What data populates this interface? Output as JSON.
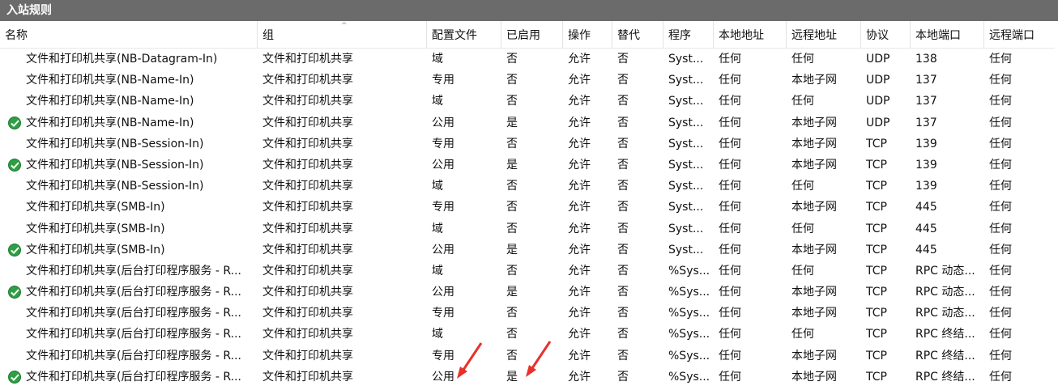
{
  "panel": {
    "title": "入站规则"
  },
  "columns": [
    "名称",
    "组",
    "配置文件",
    "已启用",
    "操作",
    "替代",
    "程序",
    "本地地址",
    "远程地址",
    "协议",
    "本地端口",
    "远程端口"
  ],
  "rows": [
    {
      "enabled_icon": false,
      "name": "文件和打印机共享(NB-Datagram-In)",
      "group": "文件和打印机共享",
      "profile": "域",
      "enabled": "否",
      "action": "允许",
      "override": "否",
      "program": "Syst...",
      "local_addr": "任何",
      "remote_addr": "任何",
      "protocol": "UDP",
      "local_port": "138",
      "remote_port": "任何"
    },
    {
      "enabled_icon": false,
      "name": "文件和打印机共享(NB-Name-In)",
      "group": "文件和打印机共享",
      "profile": "专用",
      "enabled": "否",
      "action": "允许",
      "override": "否",
      "program": "Syst...",
      "local_addr": "任何",
      "remote_addr": "本地子网",
      "protocol": "UDP",
      "local_port": "137",
      "remote_port": "任何"
    },
    {
      "enabled_icon": false,
      "name": "文件和打印机共享(NB-Name-In)",
      "group": "文件和打印机共享",
      "profile": "域",
      "enabled": "否",
      "action": "允许",
      "override": "否",
      "program": "Syst...",
      "local_addr": "任何",
      "remote_addr": "任何",
      "protocol": "UDP",
      "local_port": "137",
      "remote_port": "任何"
    },
    {
      "enabled_icon": true,
      "name": "文件和打印机共享(NB-Name-In)",
      "group": "文件和打印机共享",
      "profile": "公用",
      "enabled": "是",
      "action": "允许",
      "override": "否",
      "program": "Syst...",
      "local_addr": "任何",
      "remote_addr": "本地子网",
      "protocol": "UDP",
      "local_port": "137",
      "remote_port": "任何"
    },
    {
      "enabled_icon": false,
      "name": "文件和打印机共享(NB-Session-In)",
      "group": "文件和打印机共享",
      "profile": "专用",
      "enabled": "否",
      "action": "允许",
      "override": "否",
      "program": "Syst...",
      "local_addr": "任何",
      "remote_addr": "本地子网",
      "protocol": "TCP",
      "local_port": "139",
      "remote_port": "任何"
    },
    {
      "enabled_icon": true,
      "name": "文件和打印机共享(NB-Session-In)",
      "group": "文件和打印机共享",
      "profile": "公用",
      "enabled": "是",
      "action": "允许",
      "override": "否",
      "program": "Syst...",
      "local_addr": "任何",
      "remote_addr": "本地子网",
      "protocol": "TCP",
      "local_port": "139",
      "remote_port": "任何"
    },
    {
      "enabled_icon": false,
      "name": "文件和打印机共享(NB-Session-In)",
      "group": "文件和打印机共享",
      "profile": "域",
      "enabled": "否",
      "action": "允许",
      "override": "否",
      "program": "Syst...",
      "local_addr": "任何",
      "remote_addr": "任何",
      "protocol": "TCP",
      "local_port": "139",
      "remote_port": "任何"
    },
    {
      "enabled_icon": false,
      "name": "文件和打印机共享(SMB-In)",
      "group": "文件和打印机共享",
      "profile": "专用",
      "enabled": "否",
      "action": "允许",
      "override": "否",
      "program": "Syst...",
      "local_addr": "任何",
      "remote_addr": "本地子网",
      "protocol": "TCP",
      "local_port": "445",
      "remote_port": "任何"
    },
    {
      "enabled_icon": false,
      "name": "文件和打印机共享(SMB-In)",
      "group": "文件和打印机共享",
      "profile": "域",
      "enabled": "否",
      "action": "允许",
      "override": "否",
      "program": "Syst...",
      "local_addr": "任何",
      "remote_addr": "任何",
      "protocol": "TCP",
      "local_port": "445",
      "remote_port": "任何"
    },
    {
      "enabled_icon": true,
      "name": "文件和打印机共享(SMB-In)",
      "group": "文件和打印机共享",
      "profile": "公用",
      "enabled": "是",
      "action": "允许",
      "override": "否",
      "program": "Syst...",
      "local_addr": "任何",
      "remote_addr": "本地子网",
      "protocol": "TCP",
      "local_port": "445",
      "remote_port": "任何"
    },
    {
      "enabled_icon": false,
      "name": "文件和打印机共享(后台打印程序服务 - R...",
      "group": "文件和打印机共享",
      "profile": "域",
      "enabled": "否",
      "action": "允许",
      "override": "否",
      "program": "%Sys...",
      "local_addr": "任何",
      "remote_addr": "任何",
      "protocol": "TCP",
      "local_port": "RPC 动态...",
      "remote_port": "任何"
    },
    {
      "enabled_icon": true,
      "name": "文件和打印机共享(后台打印程序服务 - R...",
      "group": "文件和打印机共享",
      "profile": "公用",
      "enabled": "是",
      "action": "允许",
      "override": "否",
      "program": "%Sys...",
      "local_addr": "任何",
      "remote_addr": "本地子网",
      "protocol": "TCP",
      "local_port": "RPC 动态...",
      "remote_port": "任何"
    },
    {
      "enabled_icon": false,
      "name": "文件和打印机共享(后台打印程序服务 - R...",
      "group": "文件和打印机共享",
      "profile": "专用",
      "enabled": "否",
      "action": "允许",
      "override": "否",
      "program": "%Sys...",
      "local_addr": "任何",
      "remote_addr": "本地子网",
      "protocol": "TCP",
      "local_port": "RPC 动态...",
      "remote_port": "任何"
    },
    {
      "enabled_icon": false,
      "name": "文件和打印机共享(后台打印程序服务 - R...",
      "group": "文件和打印机共享",
      "profile": "域",
      "enabled": "否",
      "action": "允许",
      "override": "否",
      "program": "%Sys...",
      "local_addr": "任何",
      "remote_addr": "任何",
      "protocol": "TCP",
      "local_port": "RPC 终结...",
      "remote_port": "任何"
    },
    {
      "enabled_icon": false,
      "name": "文件和打印机共享(后台打印程序服务 - R...",
      "group": "文件和打印机共享",
      "profile": "专用",
      "enabled": "否",
      "action": "允许",
      "override": "否",
      "program": "%Sys...",
      "local_addr": "任何",
      "remote_addr": "本地子网",
      "protocol": "TCP",
      "local_port": "RPC 终结...",
      "remote_port": "任何"
    },
    {
      "enabled_icon": true,
      "name": "文件和打印机共享(后台打印程序服务 - R...",
      "group": "文件和打印机共享",
      "profile": "公用",
      "enabled": "是",
      "action": "允许",
      "override": "否",
      "program": "%Sys...",
      "local_addr": "任何",
      "remote_addr": "本地子网",
      "protocol": "TCP",
      "local_port": "RPC 终结...",
      "remote_port": "任何"
    }
  ],
  "icons": {
    "enabled_rule": "check-circle-icon",
    "sort": "sort-caret-icon",
    "annotation": "red-arrow-icon"
  },
  "colors": {
    "titlebar": "#6b6b6b",
    "enabled_icon": "#2f9e44",
    "annotation_arrow": "#e8312a"
  }
}
